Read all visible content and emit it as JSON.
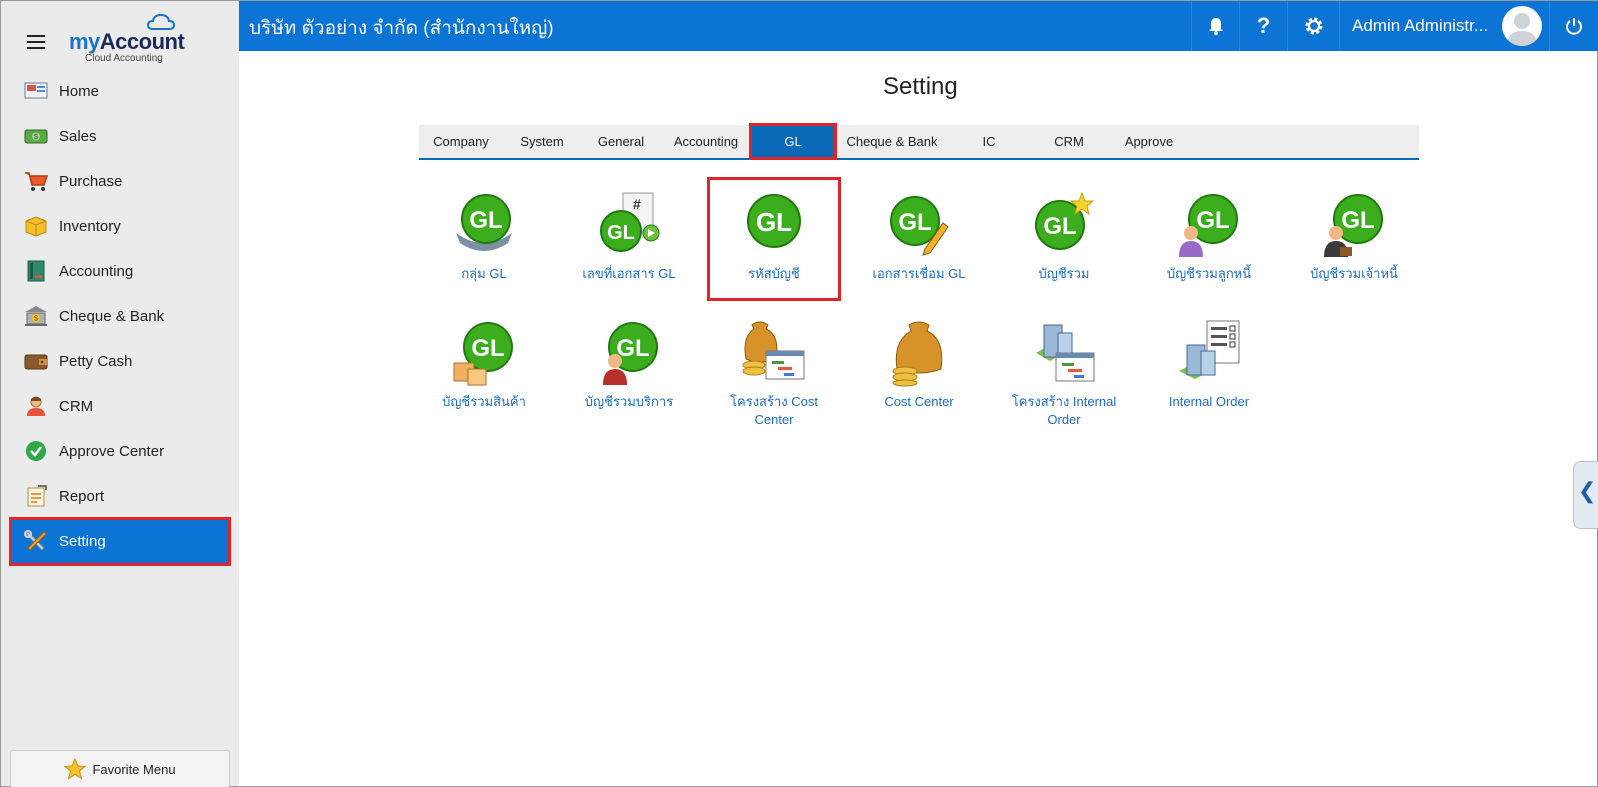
{
  "brand": {
    "name_part1": "my",
    "name_part2": "Account",
    "tagline": "Cloud Accounting"
  },
  "sidebar": {
    "items": [
      {
        "label": "Home",
        "icon": "home-icon"
      },
      {
        "label": "Sales",
        "icon": "sales-icon"
      },
      {
        "label": "Purchase",
        "icon": "cart-icon"
      },
      {
        "label": "Inventory",
        "icon": "box-icon"
      },
      {
        "label": "Accounting",
        "icon": "book-icon"
      },
      {
        "label": "Cheque & Bank",
        "icon": "bank-icon"
      },
      {
        "label": "Petty Cash",
        "icon": "wallet-icon"
      },
      {
        "label": "CRM",
        "icon": "people-icon"
      },
      {
        "label": "Approve Center",
        "icon": "check-circle-icon"
      },
      {
        "label": "Report",
        "icon": "report-icon"
      },
      {
        "label": "Setting",
        "icon": "tools-icon"
      }
    ],
    "active_index": 10,
    "favorite_label": "Favorite Menu"
  },
  "header": {
    "company": "บริษัท ตัวอย่าง จำกัด (สำนักงานใหญ่)",
    "user": "Admin Administr...",
    "help_glyph": "?"
  },
  "main": {
    "title": "Setting",
    "tabs": [
      "Company",
      "System",
      "General",
      "Accounting",
      "GL",
      "Cheque & Bank",
      "IC",
      "CRM",
      "Approve"
    ],
    "active_tab": 4,
    "tiles": [
      {
        "label": "กลุ่ม GL",
        "icon": "gl-group-icon"
      },
      {
        "label": "เลขที่เอกสาร GL",
        "icon": "gl-document-number-icon"
      },
      {
        "label": "รหัสบัญชี",
        "icon": "gl-account-code-icon"
      },
      {
        "label": "เอกสารเชื่อม GL",
        "icon": "gl-link-document-icon"
      },
      {
        "label": "บัญชีรวม",
        "icon": "gl-control-account-icon"
      },
      {
        "label": "บัญชีรวมลูกหนี้",
        "icon": "gl-debtor-account-icon"
      },
      {
        "label": "บัญชีรวมเจ้าหนี้",
        "icon": "gl-creditor-account-icon"
      },
      {
        "label": "บัญชีรวมสินค้า",
        "icon": "gl-inventory-account-icon"
      },
      {
        "label": "บัญชีรวมบริการ",
        "icon": "gl-service-account-icon"
      },
      {
        "label": "โครงสร้าง Cost Center",
        "icon": "cost-center-structure-icon"
      },
      {
        "label": "Cost Center",
        "icon": "cost-center-icon"
      },
      {
        "label": "โครงสร้าง Internal Order",
        "icon": "internal-order-structure-icon"
      },
      {
        "label": "Internal Order",
        "icon": "internal-order-icon"
      }
    ],
    "selected_tile": 2,
    "gl_badge_text": "GL"
  },
  "side_tab_glyph": "❮",
  "colors": {
    "header": "#0b74d4",
    "sidebar": "#ebebeb",
    "highlight": "#e0242a",
    "link": "#1a6fc4",
    "gl_green": "#3cae1e"
  }
}
